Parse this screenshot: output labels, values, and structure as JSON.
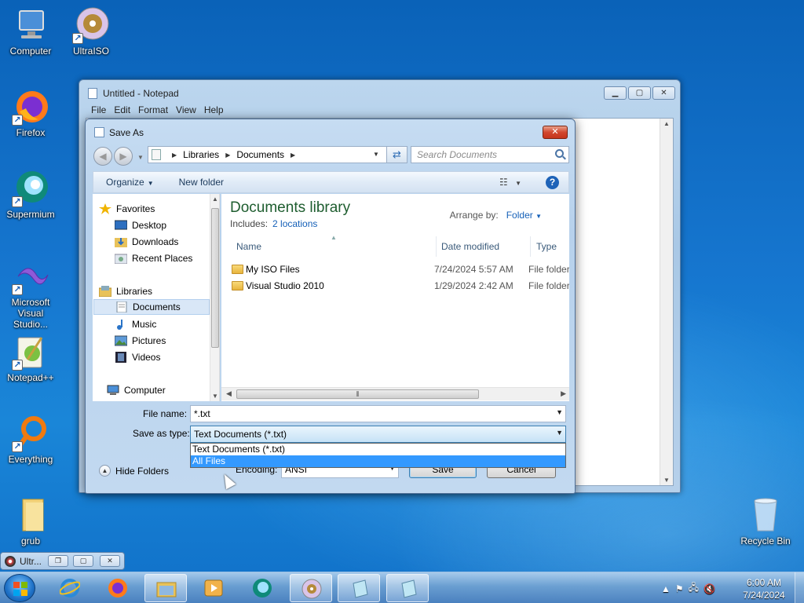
{
  "desktop": {
    "icons": [
      {
        "label": "Computer",
        "icon": "computer-icon"
      },
      {
        "label": "UltraISO",
        "icon": "ultraiso-disc-icon"
      },
      {
        "label": "Firefox",
        "icon": "firefox-icon"
      },
      {
        "label": "Supermium",
        "icon": "supermium-icon"
      },
      {
        "label": "Microsoft Visual Studio...",
        "icon": "visual-studio-icon"
      },
      {
        "label": "Notepad++",
        "icon": "notepadpp-icon"
      },
      {
        "label": "Everything",
        "icon": "everything-search-icon"
      },
      {
        "label": "grub",
        "icon": "folder-icon"
      },
      {
        "label": "Recycle Bin",
        "icon": "recycle-bin-icon"
      }
    ]
  },
  "notepad": {
    "title": "Untitled - Notepad",
    "menu": [
      "File",
      "Edit",
      "Format",
      "View",
      "Help"
    ]
  },
  "save_dialog": {
    "title": "Save As",
    "breadcrumb": [
      "Libraries",
      "Documents"
    ],
    "search_placeholder": "Search Documents",
    "toolbar": {
      "organize": "Organize",
      "new_folder": "New folder"
    },
    "nav": {
      "favorites": "Favorites",
      "desktop": "Desktop",
      "downloads": "Downloads",
      "recent": "Recent Places",
      "libraries": "Libraries",
      "documents": "Documents",
      "music": "Music",
      "pictures": "Pictures",
      "videos": "Videos",
      "computer": "Computer"
    },
    "library": {
      "title": "Documents library",
      "includes_label": "Includes:",
      "locations_link": "2 locations",
      "arrange_label": "Arrange by:",
      "arrange_value": "Folder"
    },
    "columns": {
      "name": "Name",
      "date": "Date modified",
      "type": "Type"
    },
    "files": [
      {
        "name": "My ISO Files",
        "date": "7/24/2024 5:57 AM",
        "type": "File folder"
      },
      {
        "name": "Visual Studio 2010",
        "date": "1/29/2024 2:42 AM",
        "type": "File folder"
      }
    ],
    "file_name_label": "File name:",
    "file_name_value": "*.txt",
    "save_type_label": "Save as type:",
    "save_type_value": "Text Documents (*.txt)",
    "type_options": [
      "Text Documents (*.txt)",
      "All Files"
    ],
    "encoding_label": "Encoding:",
    "encoding_value": "ANSI",
    "save_button": "Save",
    "cancel_button": "Cancel",
    "hide_folders": "Hide Folders"
  },
  "taskbar": {
    "mini_window_title": "Ultr...",
    "clock_time": "6:00 AM",
    "clock_date": "7/24/2024"
  }
}
